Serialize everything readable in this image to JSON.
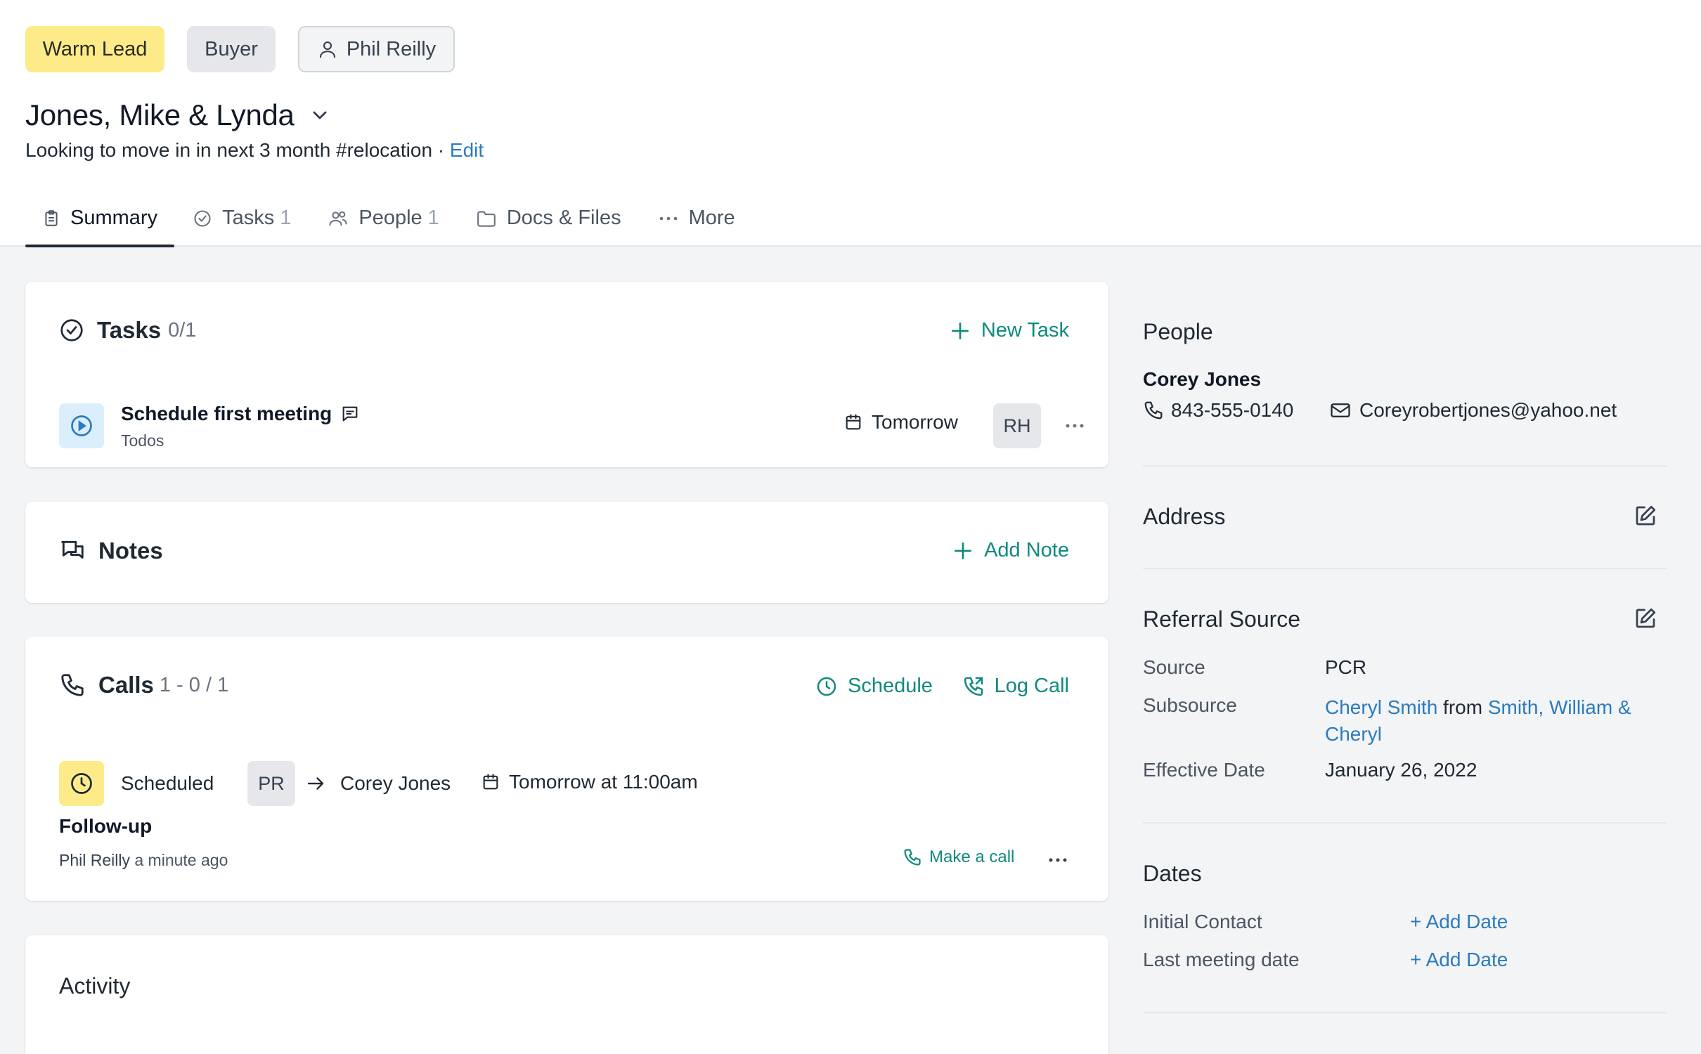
{
  "header": {
    "tags": {
      "lead": "Warm Lead",
      "type": "Buyer",
      "agent": "Phil Reilly"
    },
    "title": "Jones, Mike & Lynda",
    "subtitle": "Looking to move in in next 3 month #relocation",
    "separator": "·",
    "edit_label": "Edit",
    "tabs": [
      {
        "label": "Summary",
        "count": ""
      },
      {
        "label": "Tasks",
        "count": "1"
      },
      {
        "label": "People",
        "count": "1"
      },
      {
        "label": "Docs & Files",
        "count": ""
      },
      {
        "label": "More",
        "count": ""
      }
    ]
  },
  "tasks": {
    "title": "Tasks",
    "count": "0/1",
    "new_label": "New Task",
    "items": [
      {
        "title": "Schedule first meeting",
        "list": "Todos",
        "due": "Tomorrow",
        "assignee": "RH"
      }
    ]
  },
  "notes": {
    "title": "Notes",
    "add_label": "Add Note"
  },
  "calls": {
    "title": "Calls",
    "count": "1 - 0 / 1",
    "schedule_label": "Schedule",
    "log_label": "Log Call",
    "item": {
      "status": "Scheduled",
      "from": "PR",
      "to": "Corey Jones",
      "when": "Tomorrow at 11:00am",
      "subject": "Follow-up",
      "author": "Phil Reilly",
      "time_ago": "a minute ago",
      "make_call_label": "Make a call"
    }
  },
  "activity": {
    "title": "Activity"
  },
  "sidebar": {
    "people": {
      "title": "People",
      "name": "Corey Jones",
      "phone": "843-555-0140",
      "email": "Coreyrobertjones@yahoo.net"
    },
    "address": {
      "title": "Address"
    },
    "referral": {
      "title": "Referral Source",
      "source_label": "Source",
      "source_value": "PCR",
      "subsource_label": "Subsource",
      "subsource_person": "Cheryl Smith",
      "subsource_from": "from",
      "subsource_contact": "Smith, William & Cheryl",
      "effective_label": "Effective Date",
      "effective_value": "January 26, 2022"
    },
    "dates": {
      "title": "Dates",
      "rows": [
        {
          "label": "Initial Contact",
          "action": "+ Add Date"
        },
        {
          "label": "Last meeting date",
          "action": "+ Add Date"
        }
      ]
    }
  },
  "colors": {
    "accent_teal": "#0f8a7e",
    "link_blue": "#2b7bbf",
    "warm_yellow": "#fdeb8a",
    "scheduled_yellow": "#fdeb8a",
    "task_icon_bg": "#dbeefc"
  },
  "icons": {
    "agent": "user-icon",
    "title_toggle": "chevron-down-icon",
    "tabs": [
      "clipboard-icon",
      "check-circle-icon",
      "users-icon",
      "folder-icon",
      "ellipsis-icon"
    ],
    "task": "play-circle-icon",
    "comment": "comment-icon",
    "calendar": "calendar-icon",
    "more": "ellipsis-icon",
    "notes": "chat-bubbles-icon",
    "calls": "phone-icon",
    "schedule": "clock-icon",
    "log_call": "phone-log-icon",
    "arrow": "arrow-right-icon",
    "mail": "mail-icon",
    "edit": "edit-icon"
  }
}
